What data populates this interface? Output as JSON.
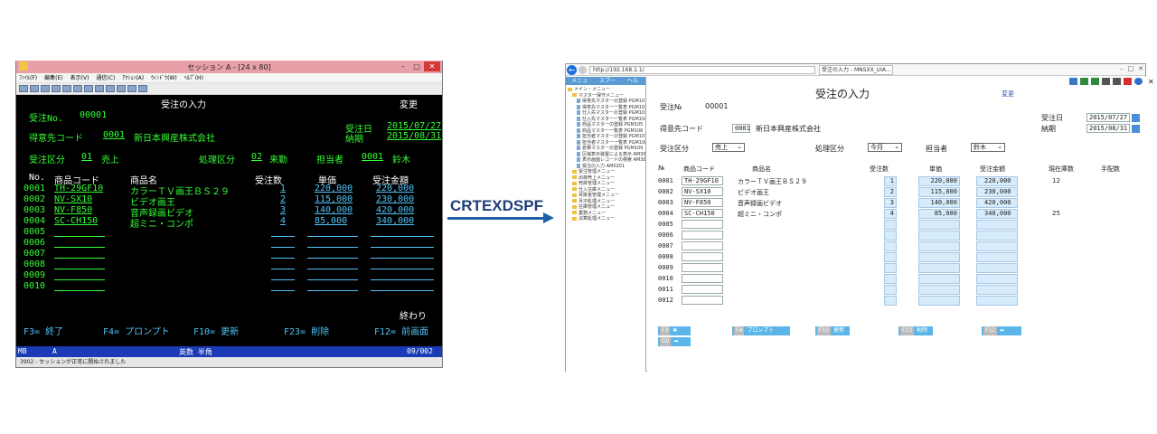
{
  "left": {
    "window_title": "セッション A - [24 x 80]",
    "menu": [
      "ﾌｧｲﾙ(F)",
      "編集(E)",
      "表示(V)",
      "通信(C)",
      "ｱｸｼｮﾝ(A)",
      "ｳｨﾝﾄﾞｳ(W)",
      "ﾍﾙﾌﾟ(H)"
    ],
    "screen": {
      "title": "受注の入力",
      "mode": "変更",
      "order_no_label": "受注No.",
      "order_no": "00001",
      "order_date_label": "受注日",
      "order_date": "2015/07/27",
      "customer_label": "得意先コード",
      "customer_code": "0001",
      "customer_name": "新日本興産株式会社",
      "delivery_label": "納期",
      "delivery_date": "2015/08/31",
      "order_type_label": "受注区分",
      "order_type_code": "01",
      "order_type_name": "売上",
      "proc_label": "処理区分",
      "proc_code": "02",
      "proc_name": "来勤",
      "staff_label": "担当者",
      "staff_code": "0001",
      "staff_name": "鈴木",
      "col_no": "No.",
      "col_code": "商品コード",
      "col_name": "商品名",
      "col_qty": "受注数",
      "col_price": "単価",
      "col_amount": "受注金額",
      "rows": [
        {
          "no": "0001",
          "code": "TH-29GF10",
          "name": "カラーＴＶ画王ＢＳ２９",
          "qty": "1",
          "price": "220,000",
          "amount": "220,000"
        },
        {
          "no": "0002",
          "code": "NV-SX10",
          "name": "ビデオ画王",
          "qty": "2",
          "price": "115,000",
          "amount": "230,000"
        },
        {
          "no": "0003",
          "code": "NV-F850",
          "name": "音声録画ビデオ",
          "qty": "3",
          "price": "140,000",
          "amount": "420,000"
        },
        {
          "no": "0004",
          "code": "SC-CH150",
          "name": "超ミニ・コンポ",
          "qty": "4",
          "price": "85,000",
          "amount": "340,000"
        },
        {
          "no": "0005"
        },
        {
          "no": "0006"
        },
        {
          "no": "0007"
        },
        {
          "no": "0008"
        },
        {
          "no": "0009"
        },
        {
          "no": "0010"
        }
      ],
      "end_label": "終わり",
      "fkeys": [
        "F3= 終了",
        "F4= プロンプト",
        "F10= 更新",
        "F23= 削除",
        "F12= 前画面"
      ]
    },
    "oia": {
      "left": "MB",
      "a": "A",
      "mode": "英数 半角",
      "pos": "09/002"
    },
    "status": "3902 - セッションが正常に開始されました"
  },
  "arrow_label": "CRTEXDSPF",
  "right": {
    "address": "http://192.168.1.1/",
    "tab_title": "受注の入力 - MNSXX_UIA...",
    "left_tabs": [
      "メニュー",
      "スプール",
      "ヘルプ"
    ],
    "tree": [
      {
        "t": "メイン・メニュー",
        "lvl": 0,
        "k": "fold"
      },
      {
        "t": "マスター保守メニュー",
        "lvl": 1,
        "k": "fold"
      },
      {
        "t": "得意先マスターの登録 PGM101",
        "lvl": 2,
        "k": "doc"
      },
      {
        "t": "得意先マスター一覧表 PGM102",
        "lvl": 2,
        "k": "doc"
      },
      {
        "t": "仕入先マスターの登録 PGM103",
        "lvl": 2,
        "k": "doc"
      },
      {
        "t": "仕入先マスター一覧表 PGM104",
        "lvl": 2,
        "k": "doc"
      },
      {
        "t": "商品マスターの登録 PGM105",
        "lvl": 2,
        "k": "doc"
      },
      {
        "t": "商品マスター一覧表 PGM106",
        "lvl": 2,
        "k": "doc"
      },
      {
        "t": "担当者マスターの登録 PGM107",
        "lvl": 2,
        "k": "doc"
      },
      {
        "t": "担当者マスター一覧表 PGM108",
        "lvl": 2,
        "k": "doc"
      },
      {
        "t": "倉庫マスターの登録 PGM109",
        "lvl": 2,
        "k": "doc"
      },
      {
        "t": "区域表示装置による表示 AM300",
        "lvl": 2,
        "k": "doc"
      },
      {
        "t": "表示画面レコードの検索 AM301",
        "lvl": 2,
        "k": "doc"
      },
      {
        "t": "受注の入力 AM0201",
        "lvl": 2,
        "k": "doc"
      },
      {
        "t": "受注管理メニュー",
        "lvl": 1,
        "k": "fold"
      },
      {
        "t": "出荷売上メニュー",
        "lvl": 1,
        "k": "fold"
      },
      {
        "t": "売掛管理メニュー",
        "lvl": 1,
        "k": "fold"
      },
      {
        "t": "仕入在庫メニュー",
        "lvl": 1,
        "k": "fold"
      },
      {
        "t": "買掛金管理メニュー",
        "lvl": 1,
        "k": "fold"
      },
      {
        "t": "月次処理メニュー",
        "lvl": 1,
        "k": "fold"
      },
      {
        "t": "在庫管理メニュー",
        "lvl": 1,
        "k": "fold"
      },
      {
        "t": "業務メニュー",
        "lvl": 1,
        "k": "fold"
      },
      {
        "t": "決算処理メニュー",
        "lvl": 1,
        "k": "fold"
      }
    ],
    "form": {
      "title": "受注の入力",
      "mode": "変更",
      "order_no_label": "受注№",
      "order_no": "00001",
      "order_date_label": "受注日",
      "order_date": "2015/07/27",
      "delivery_label": "納期",
      "delivery_date": "2015/08/31",
      "customer_label": "得意先コード",
      "customer_code": "0001",
      "customer_name": "新日本興産株式会社",
      "order_type_label": "受注区分",
      "order_type_value": "売上",
      "proc_label": "処理区分",
      "proc_value": "今月",
      "staff_label": "担当者",
      "staff_value": "鈴木",
      "col_no": "№",
      "col_code": "商品コード",
      "col_name": "商品名",
      "col_qty": "受注数",
      "col_price": "単価",
      "col_amount": "受注金額",
      "col_stock": "現在庫数",
      "col_ship": "手配数",
      "rows": [
        {
          "no": "0001",
          "code": "TH-29GF10",
          "name": "カラーＴＶ画王ＢＳ２９",
          "qty": "1",
          "price": "220,000",
          "amount": "220,000",
          "stock": "12"
        },
        {
          "no": "0002",
          "code": "NV-SX10",
          "name": "ビデオ画王",
          "qty": "2",
          "price": "115,000",
          "amount": "230,000",
          "stock": ""
        },
        {
          "no": "0003",
          "code": "NV-F850",
          "name": "音声録画ビデオ",
          "qty": "3",
          "price": "140,000",
          "amount": "420,000",
          "stock": ""
        },
        {
          "no": "0004",
          "code": "SC-CH150",
          "name": "超ミニ・コンポ",
          "qty": "4",
          "price": "85,000",
          "amount": "340,000",
          "stock": "25"
        },
        {
          "no": "0005"
        },
        {
          "no": "0006"
        },
        {
          "no": "0007"
        },
        {
          "no": "0008"
        },
        {
          "no": "0009"
        },
        {
          "no": "0010"
        },
        {
          "no": "0011"
        },
        {
          "no": "0012"
        }
      ],
      "fbuttons": [
        {
          "k": "F3",
          "label": ""
        },
        {
          "k": "F4",
          "label": "プロンプト"
        },
        {
          "k": "F10",
          "label": "更新"
        },
        {
          "k": "F23",
          "label": "削除"
        },
        {
          "k": "F12",
          "label": ""
        },
        {
          "k": "G0",
          "label": ""
        }
      ]
    }
  }
}
